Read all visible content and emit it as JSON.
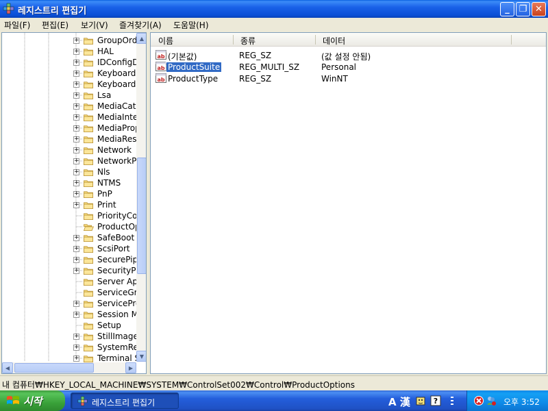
{
  "window": {
    "title": "레지스트리 편집기",
    "buttons": {
      "minimize": "_",
      "maximize": "❐",
      "close": "✕"
    }
  },
  "menu": [
    "파일(F)",
    "편집(E)",
    "보기(V)",
    "즐겨찾기(A)",
    "도움말(H)"
  ],
  "tree": {
    "items": [
      {
        "label": "GroupOrde",
        "expandable": true
      },
      {
        "label": "HAL",
        "expandable": true
      },
      {
        "label": "IDConfigDI",
        "expandable": true
      },
      {
        "label": "Keyboard",
        "expandable": true
      },
      {
        "label": "Keyboard",
        "expandable": true
      },
      {
        "label": "Lsa",
        "expandable": true
      },
      {
        "label": "MediaCate",
        "expandable": true
      },
      {
        "label": "MediaInter",
        "expandable": true
      },
      {
        "label": "MediaProp",
        "expandable": true
      },
      {
        "label": "MediaRes",
        "expandable": true
      },
      {
        "label": "Network",
        "expandable": true
      },
      {
        "label": "NetworkPr",
        "expandable": true
      },
      {
        "label": "Nls",
        "expandable": true
      },
      {
        "label": "NTMS",
        "expandable": true
      },
      {
        "label": "PnP",
        "expandable": true
      },
      {
        "label": "Print",
        "expandable": true
      },
      {
        "label": "PriorityCor",
        "expandable": false
      },
      {
        "label": "ProductOp",
        "expandable": false,
        "open": true
      },
      {
        "label": "SafeBoot",
        "expandable": true
      },
      {
        "label": "ScsiPort",
        "expandable": true
      },
      {
        "label": "SecurePip",
        "expandable": true
      },
      {
        "label": "SecurityPr",
        "expandable": true
      },
      {
        "label": "Server App",
        "expandable": false
      },
      {
        "label": "ServiceGro",
        "expandable": false
      },
      {
        "label": "ServicePro",
        "expandable": true
      },
      {
        "label": "Session M",
        "expandable": true
      },
      {
        "label": "Setup",
        "expandable": false
      },
      {
        "label": "StillImage",
        "expandable": true
      },
      {
        "label": "SystemRe",
        "expandable": true
      },
      {
        "label": "Terminal S",
        "expandable": true
      }
    ]
  },
  "list": {
    "columns": [
      "이름",
      "종류",
      "데이터"
    ],
    "rows": [
      {
        "name": "(기본값)",
        "type": "REG_SZ",
        "data": "(값 설정 안됨)",
        "selected": false
      },
      {
        "name": "ProductSuite",
        "type": "REG_MULTI_SZ",
        "data": "Personal",
        "selected": true
      },
      {
        "name": "ProductType",
        "type": "REG_SZ",
        "data": "WinNT",
        "selected": false
      }
    ]
  },
  "status": {
    "path": "내 컴퓨터₩HKEY_LOCAL_MACHINE₩SYSTEM₩ControlSet002₩Control₩ProductOptions"
  },
  "taskbar": {
    "start_label": "시작",
    "task_label": "레지스트리 편집기",
    "lang_label": "A 漢",
    "clock": "오후 3:52"
  },
  "colors": {
    "selection": "#316ac5",
    "titlebar": "#0b4fd6",
    "start": "#3aa23a"
  }
}
